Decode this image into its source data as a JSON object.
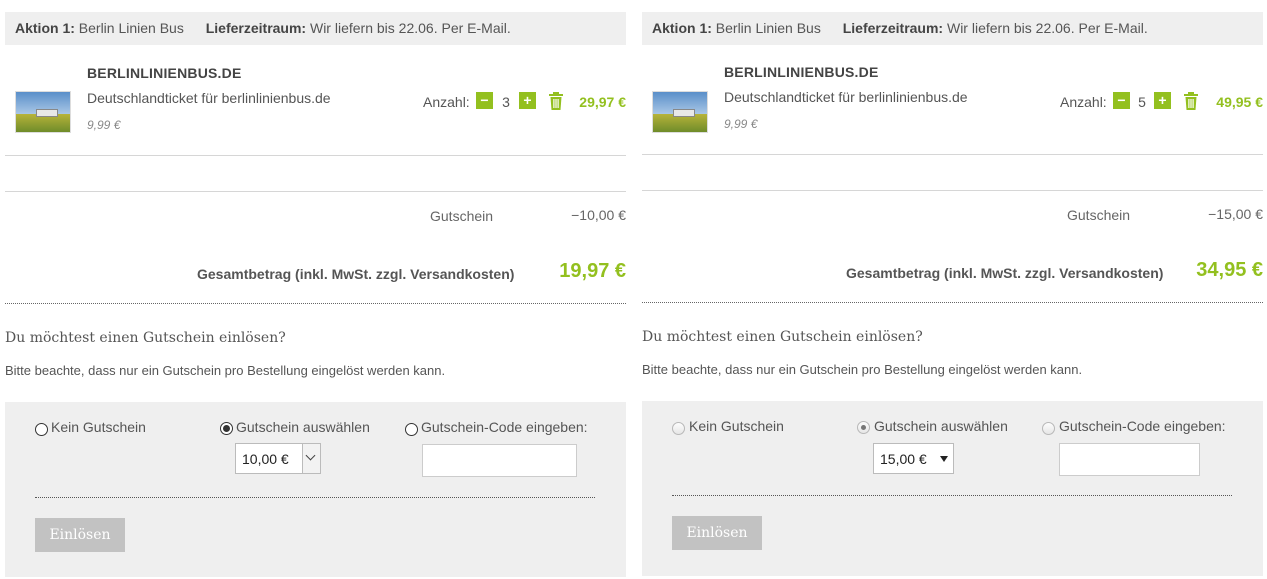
{
  "panels": [
    {
      "header": {
        "action_bold": "Aktion 1:",
        "action_text": "Berlin Linien Bus",
        "period_bold": "Lieferzeitraum:",
        "period_text": "Wir liefern bis 22.06. Per E-Mail."
      },
      "item": {
        "brand": "BERLINLINIENBUS.DE",
        "product": "Deutschlandticket für berlinlinienbus.de",
        "unit_price": "9,99 €",
        "qty_label": "Anzahl:",
        "minus": "−",
        "plus": "+",
        "qty": "3",
        "line_total": "29,97 €"
      },
      "summary": {
        "voucher_label": "Gutschein",
        "voucher_value": "−10,00 €",
        "total_label": "Gesamtbetrag (inkl. MwSt. zzgl. Versandkosten)",
        "total_value": "19,97 €"
      },
      "voucher": {
        "title": "Du möchtest einen Gutschein einlösen?",
        "note": "Bitte beachte, dass nur ein Gutschein pro Bestellung eingelöst werden kann.",
        "option_none": "Kein Gutschein",
        "option_select": "Gutschein auswählen",
        "option_code": "Gutschein-Code eingeben:",
        "selected_option": "option_select",
        "select_value": "10,00 €",
        "code_value": "",
        "redeem": "Einlösen"
      }
    },
    {
      "header": {
        "action_bold": "Aktion 1:",
        "action_text": "Berlin Linien Bus",
        "period_bold": "Lieferzeitraum:",
        "period_text": "Wir liefern bis 22.06. Per E-Mail."
      },
      "item": {
        "brand": "BERLINLINIENBUS.DE",
        "product": "Deutschlandticket für berlinlinienbus.de",
        "unit_price": "9,99 €",
        "qty_label": "Anzahl:",
        "minus": "−",
        "plus": "+",
        "qty": "5",
        "line_total": "49,95 €"
      },
      "summary": {
        "voucher_label": "Gutschein",
        "voucher_value": "−15,00 €",
        "total_label": "Gesamtbetrag (inkl. MwSt. zzgl. Versandkosten)",
        "total_value": "34,95 €"
      },
      "voucher": {
        "title": "Du möchtest einen Gutschein einlösen?",
        "note": "Bitte beachte, dass nur ein Gutschein pro Bestellung eingelöst werden kann.",
        "option_none": "Kein Gutschein",
        "option_select": "Gutschein auswählen",
        "option_code": "Gutschein-Code eingeben:",
        "selected_option": "option_select",
        "select_value": "15,00 €",
        "code_value": "",
        "redeem": "Einlösen"
      }
    }
  ],
  "colors": {
    "accent": "#93c01f",
    "header_bg": "#efefef",
    "button_disabled": "#c2c2c2"
  },
  "icons": {
    "trash": "trash-icon",
    "plus": "plus-icon",
    "minus": "minus-icon",
    "dropdown": "chevron-down-icon"
  }
}
